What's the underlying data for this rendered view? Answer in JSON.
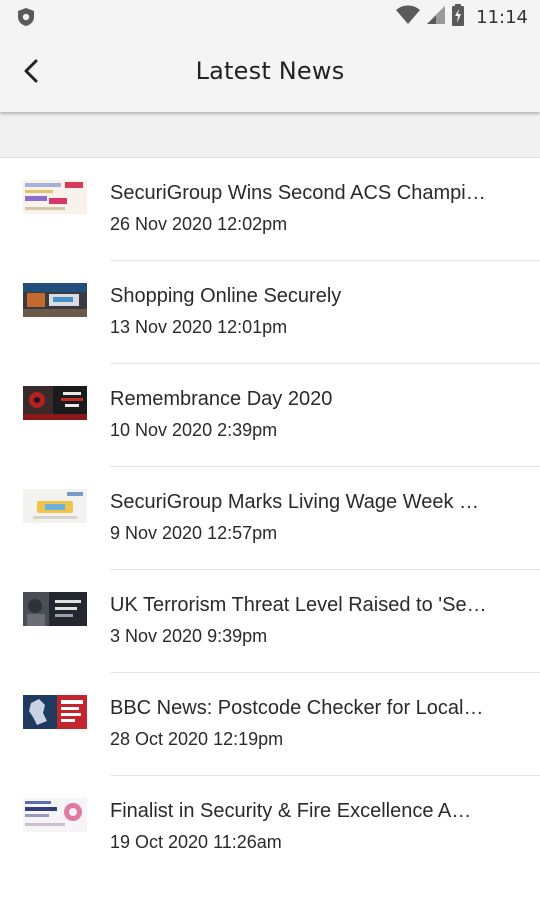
{
  "status_bar": {
    "time": "11:14",
    "icons": [
      "shield-icon",
      "wifi-icon",
      "signal-icon",
      "battery-icon"
    ]
  },
  "app_bar": {
    "title": "Latest News",
    "back_icon": "chevron-left-icon"
  },
  "news": [
    {
      "title": "SecuriGroup Wins Second ACS Champi…",
      "date": "26 Nov 2020 12:02pm"
    },
    {
      "title": "Shopping Online Securely",
      "date": "13 Nov 2020 12:01pm"
    },
    {
      "title": "Remembrance Day 2020",
      "date": "10 Nov 2020 2:39pm"
    },
    {
      "title": "SecuriGroup Marks Living Wage Week …",
      "date": "9 Nov 2020 12:57pm"
    },
    {
      "title": "UK Terrorism Threat Level Raised to 'Se…",
      "date": "3 Nov 2020 9:39pm"
    },
    {
      "title": "BBC News: Postcode Checker for Local…",
      "date": "28 Oct 2020 12:19pm"
    },
    {
      "title": "Finalist in Security & Fire Excellence A…",
      "date": "19 Oct 2020 11:26am"
    }
  ]
}
